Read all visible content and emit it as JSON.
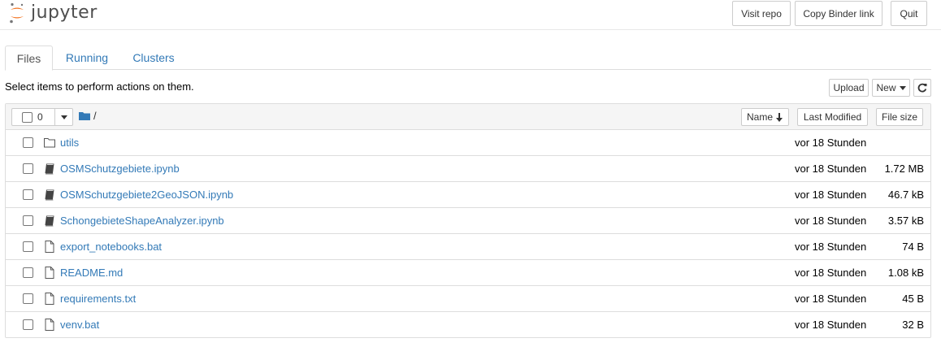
{
  "header": {
    "logo_text": "jupyter",
    "buttons": {
      "visit_repo": "Visit repo",
      "copy_binder": "Copy Binder link",
      "quit": "Quit"
    }
  },
  "tabs": [
    {
      "label": "Files",
      "active": true
    },
    {
      "label": "Running",
      "active": false
    },
    {
      "label": "Clusters",
      "active": false
    }
  ],
  "toolbar": {
    "instructions": "Select items to perform actions on them.",
    "upload_label": "Upload",
    "new_label": "New",
    "refresh_icon": "refresh-icon"
  },
  "list_header": {
    "selected_count": "0",
    "breadcrumb_root": "/",
    "sort_name_label": "Name",
    "last_modified_label": "Last Modified",
    "file_size_label": "File size"
  },
  "files": [
    {
      "type": "folder",
      "icon": "folder-icon",
      "name": "utils",
      "modified": "vor 18 Stunden",
      "size": ""
    },
    {
      "type": "notebook",
      "icon": "notebook-icon",
      "name": "OSMSchutzgebiete.ipynb",
      "modified": "vor 18 Stunden",
      "size": "1.72 MB"
    },
    {
      "type": "notebook",
      "icon": "notebook-icon",
      "name": "OSMSchutzgebiete2GeoJSON.ipynb",
      "modified": "vor 18 Stunden",
      "size": "46.7 kB"
    },
    {
      "type": "notebook",
      "icon": "notebook-icon",
      "name": "SchongebieteShapeAnalyzer.ipynb",
      "modified": "vor 18 Stunden",
      "size": "3.57 kB"
    },
    {
      "type": "file",
      "icon": "file-icon",
      "name": "export_notebooks.bat",
      "modified": "vor 18 Stunden",
      "size": "74 B"
    },
    {
      "type": "file",
      "icon": "file-icon",
      "name": "README.md",
      "modified": "vor 18 Stunden",
      "size": "1.08 kB"
    },
    {
      "type": "file",
      "icon": "file-icon",
      "name": "requirements.txt",
      "modified": "vor 18 Stunden",
      "size": "45 B"
    },
    {
      "type": "file",
      "icon": "file-icon",
      "name": "venv.bat",
      "modified": "vor 18 Stunden",
      "size": "32 B"
    }
  ],
  "colors": {
    "link": "#337ab7",
    "jupyter_orange": "#f37726",
    "border": "#dddddd",
    "header_bg": "#f5f5f5"
  }
}
